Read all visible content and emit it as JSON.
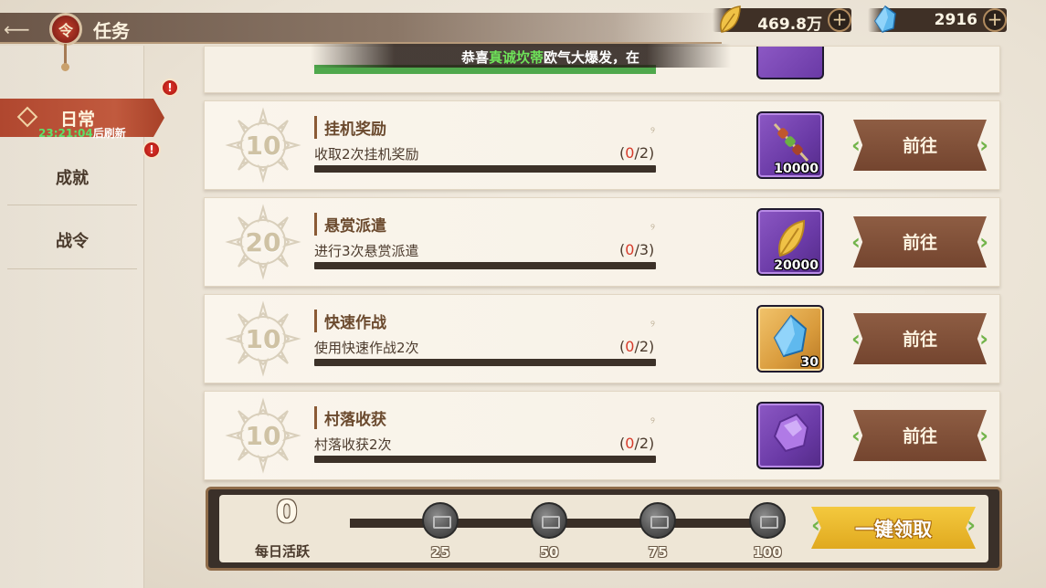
{
  "header": {
    "title": "任务",
    "emblem_glyph": "令",
    "back_icon": "back-arrow-icon"
  },
  "currency": {
    "gold": "469.8万",
    "gem": "2916"
  },
  "announcement": {
    "prefix": "恭喜",
    "highlight": "真诚坎蒂",
    "suffix": "欧气大爆发，在"
  },
  "sidebar": {
    "tabs": [
      {
        "label": "日常",
        "timer": "23:21:04",
        "timer_suffix": "后刷新",
        "active": true
      },
      {
        "label": "成就"
      },
      {
        "label": "战令"
      }
    ],
    "badge": "!"
  },
  "tasks": [
    {
      "points": "10",
      "name": "挂机奖励",
      "desc": "收取2次挂机奖励",
      "current": "0",
      "total": "/2)",
      "reward_qty": "10000",
      "reward_icon": "skewer-icon",
      "button": "前往"
    },
    {
      "points": "20",
      "name": "悬赏派遣",
      "desc": "进行3次悬赏派遣",
      "current": "0",
      "total": "/3)",
      "reward_qty": "20000",
      "reward_icon": "gold-leaf-icon",
      "button": "前往"
    },
    {
      "points": "10",
      "name": "快速作战",
      "desc": "使用快速作战2次",
      "current": "0",
      "total": "/2)",
      "reward_qty": "30",
      "reward_icon": "blue-crystal-icon",
      "button": "前往"
    },
    {
      "points": "10",
      "name": "村落收获",
      "desc": "村落收获2次",
      "current": "0",
      "total": "/2)",
      "reward_qty": "",
      "reward_icon": "purple-ore-icon",
      "button": "前往"
    }
  ],
  "progress_open": "(",
  "activity": {
    "value": "0",
    "label": "每日活跃",
    "milestones": [
      "25",
      "50",
      "75",
      "100"
    ],
    "claim_all": "一键领取"
  },
  "colors": {
    "accent_red": "#c15a3e",
    "timer_green": "#5ee06a",
    "claim_gold": "#f4c93e"
  }
}
